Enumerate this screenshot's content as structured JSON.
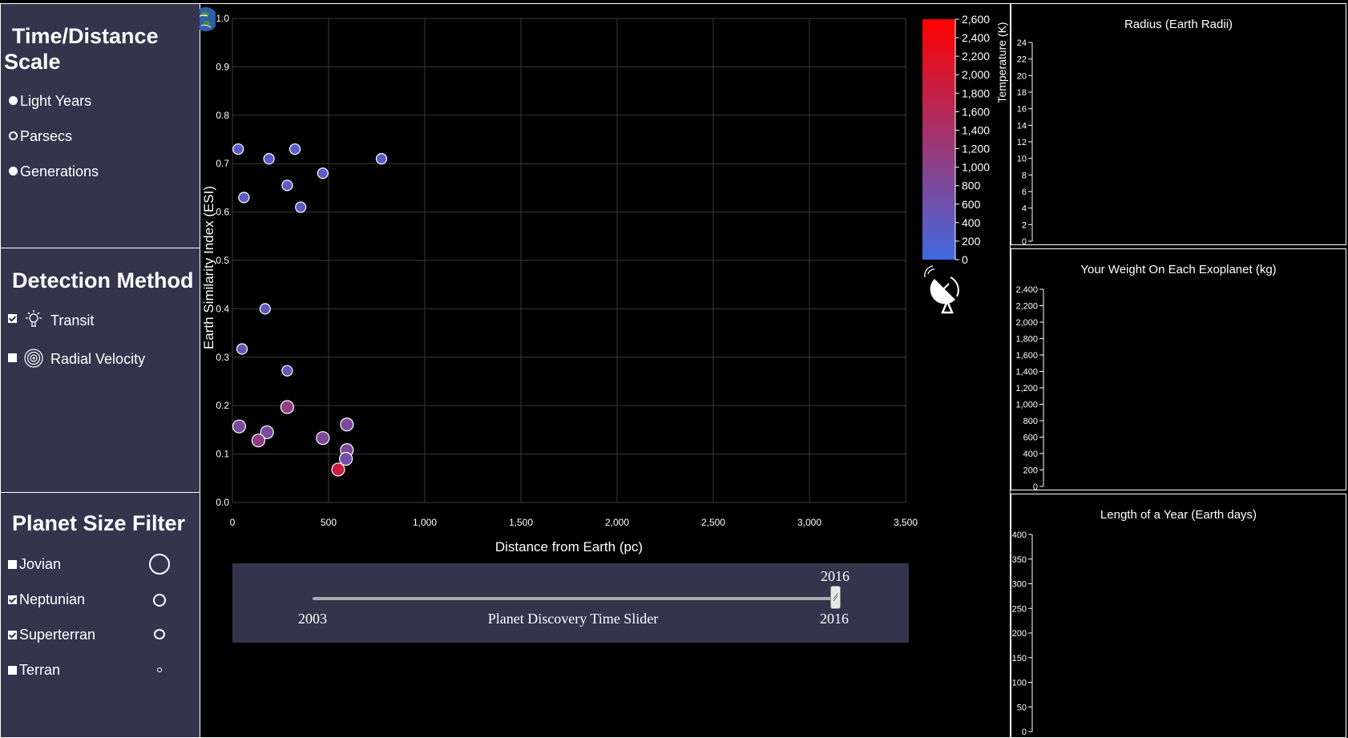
{
  "scale_panel": {
    "title_line1": "Time/Distance",
    "title_line2": "Scale",
    "options": [
      {
        "label": "Light Years",
        "selected": true
      },
      {
        "label": "Parsecs",
        "selected": false
      },
      {
        "label": "Generations",
        "selected": true
      }
    ]
  },
  "detection_panel": {
    "title": "Detection Method",
    "options": [
      {
        "label": "Transit",
        "checked": true,
        "icon": "lightbulb-icon"
      },
      {
        "label": "Radial Velocity",
        "checked": false,
        "icon": "target-icon"
      }
    ]
  },
  "size_panel": {
    "title": "Planet Size Filter",
    "options": [
      {
        "label": "Jovian",
        "checked": false
      },
      {
        "label": "Neptunian",
        "checked": true
      },
      {
        "label": "Superterran",
        "checked": true
      },
      {
        "label": "Terran",
        "checked": false
      }
    ]
  },
  "colors": {
    "panel_bg": "#35344d",
    "temp_low": "#4169e1",
    "temp_high": "#ff0000"
  },
  "chart_data": [
    {
      "type": "scatter",
      "xlabel": "Distance from Earth (pc)",
      "ylabel": "Earth Similarity Index (ESI)",
      "xlim": [
        0,
        3500
      ],
      "ylim": [
        0,
        1.0
      ],
      "x_ticks": [
        "0",
        "500",
        "1,000",
        "1,500",
        "2,000",
        "2,500",
        "3,000",
        "3,500"
      ],
      "y_ticks": [
        "0.0",
        "0.1",
        "0.2",
        "0.3",
        "0.4",
        "0.5",
        "0.6",
        "0.7",
        "0.8",
        "0.9",
        "1.0"
      ],
      "grid": true,
      "points": [
        {
          "x": 30,
          "y": 0.73,
          "temp": 300
        },
        {
          "x": 190,
          "y": 0.71,
          "temp": 300
        },
        {
          "x": 325,
          "y": 0.73,
          "temp": 320
        },
        {
          "x": 775,
          "y": 0.71,
          "temp": 300
        },
        {
          "x": 285,
          "y": 0.655,
          "temp": 350
        },
        {
          "x": 470,
          "y": 0.68,
          "temp": 330
        },
        {
          "x": 60,
          "y": 0.63,
          "temp": 350
        },
        {
          "x": 355,
          "y": 0.61,
          "temp": 330
        },
        {
          "x": 170,
          "y": 0.4,
          "temp": 450
        },
        {
          "x": 50,
          "y": 0.317,
          "temp": 500
        },
        {
          "x": 285,
          "y": 0.272,
          "temp": 500
        },
        {
          "x": 285,
          "y": 0.197,
          "temp": 1050
        },
        {
          "x": 35,
          "y": 0.157,
          "temp": 750
        },
        {
          "x": 180,
          "y": 0.145,
          "temp": 750
        },
        {
          "x": 135,
          "y": 0.128,
          "temp": 1100
        },
        {
          "x": 470,
          "y": 0.133,
          "temp": 850
        },
        {
          "x": 595,
          "y": 0.161,
          "temp": 800
        },
        {
          "x": 595,
          "y": 0.108,
          "temp": 850
        },
        {
          "x": 590,
          "y": 0.09,
          "temp": 700
        },
        {
          "x": 550,
          "y": 0.068,
          "temp": 1850
        }
      ],
      "colorbar": {
        "label": "Temperature (K)",
        "min": 0,
        "max": 2600,
        "ticks": [
          "0",
          "200",
          "400",
          "600",
          "800",
          "1,000",
          "1,200",
          "1,400",
          "1,600",
          "1,800",
          "2,000",
          "2,200",
          "2,400",
          "2,600"
        ]
      }
    },
    {
      "type": "bar",
      "title": "Radius (Earth Radii)",
      "ylim": [
        0,
        24
      ],
      "y_ticks": [
        "0",
        "2",
        "4",
        "6",
        "8",
        "10",
        "12",
        "14",
        "16",
        "18",
        "20",
        "22",
        "24"
      ],
      "values": []
    },
    {
      "type": "bar",
      "title": "Your Weight On Each Exoplanet (kg)",
      "ylim": [
        0,
        2400
      ],
      "y_ticks": [
        "0",
        "200",
        "400",
        "600",
        "800",
        "1,000",
        "1,200",
        "1,400",
        "1,600",
        "1,800",
        "2,000",
        "2,200",
        "2,400"
      ],
      "values": []
    },
    {
      "type": "bar",
      "title": "Length of a Year (Earth days)",
      "ylim": [
        0,
        400
      ],
      "y_ticks": [
        "0",
        "50",
        "100",
        "150",
        "200",
        "250",
        "300",
        "350",
        "400"
      ],
      "values": []
    }
  ],
  "slider": {
    "label": "Planet Discovery Time Slider",
    "min_label": "2003",
    "max_label": "2016",
    "value_label": "2016",
    "min": 2003,
    "max": 2016,
    "value": 2016
  },
  "icons": {
    "globe": "globe-icon",
    "telescope": "radio-telescope-icon"
  }
}
